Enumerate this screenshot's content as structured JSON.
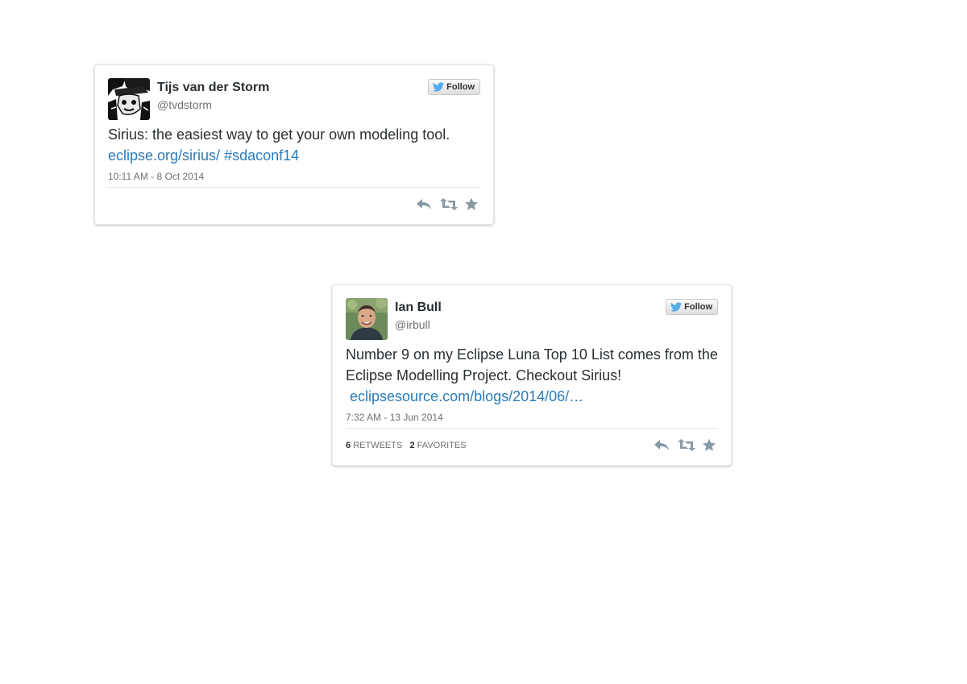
{
  "tweets": [
    {
      "name": "Tijs van der Storm",
      "handle": "@tvdstorm",
      "follow_label": "Follow",
      "text": "Sirius: the easiest way to get your own modeling tool. ",
      "link_1": "eclipse.org/sirius/",
      "link_2": " #sdaconf14",
      "date": "10:11 AM - 8 Oct 2014"
    },
    {
      "name": "Ian Bull",
      "handle": "@irbull",
      "follow_label": "Follow",
      "text": "Number 9 on my Eclipse Luna Top 10 List comes from the Eclipse Modelling Project. Checkout Sirius! ",
      "link_1": "eclipsesource.com/blogs/2014/06/…",
      "date": "7:32 AM - 13 Jun 2014",
      "retweets": "6",
      "retweets_label": "Retweets",
      "favorites": "2",
      "favorites_label": "Favorites"
    }
  ],
  "icons": [
    "twitter-bird-icon",
    "reply-icon",
    "retweet-icon",
    "favorite-icon"
  ],
  "colors": {
    "link": "#2b7bb9",
    "twitter_blue": "#55acee",
    "muted": "#707070"
  }
}
